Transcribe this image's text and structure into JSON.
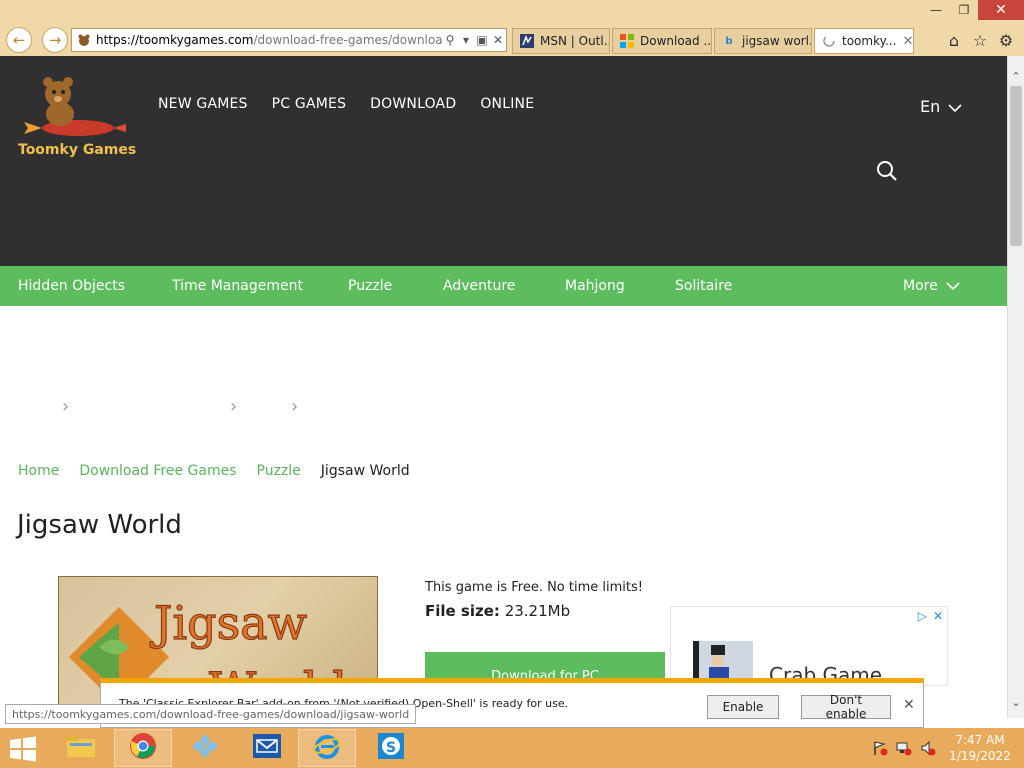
{
  "browser": {
    "url_domain": "https://toomkygames.com",
    "url_path": "/download-free-games/download/jig",
    "tabs": [
      {
        "label": "MSN | Outl..."
      },
      {
        "label": "Download ..."
      },
      {
        "label": "jigsaw worl..."
      },
      {
        "label": "toomky..."
      }
    ]
  },
  "site": {
    "logo_text": "Toomky Games",
    "top_nav": [
      "NEW GAMES",
      "PC GAMES",
      "DOWNLOAD",
      "ONLINE"
    ],
    "language": "En",
    "categories": [
      "Hidden Objects",
      "Time Management",
      "Puzzle",
      "Adventure",
      "Mahjong",
      "Solitaire"
    ],
    "more_label": "More"
  },
  "breadcrumb": [
    "Home",
    "Download Free Games",
    "Puzzle",
    "Jigsaw World"
  ],
  "page_title": "Jigsaw World",
  "game": {
    "image_title_line1": "Jigsaw",
    "image_title_line2": "World",
    "free_text": "This game is Free. No time limits!",
    "file_size_label": "File size:",
    "file_size_value": "23.21Mb",
    "download_label": "Download for PC"
  },
  "ad": {
    "title": "Crab Game"
  },
  "notification": {
    "message": "The 'Classic Explorer Bar' add-on from '(Not verified) Open-Shell' is ready for use.",
    "enable_label": "Enable",
    "dont_enable_label": "Don't enable"
  },
  "status_url": "https://toomkygames.com/download-free-games/download/jigsaw-world",
  "taskbar": {
    "time": "7:47 AM",
    "date": "1/19/2022"
  },
  "colors": {
    "header_bg": "#303030",
    "category_green": "#5cbc5e",
    "logo_gold": "#f0c24c",
    "taskbar": "#e8ab5c"
  }
}
